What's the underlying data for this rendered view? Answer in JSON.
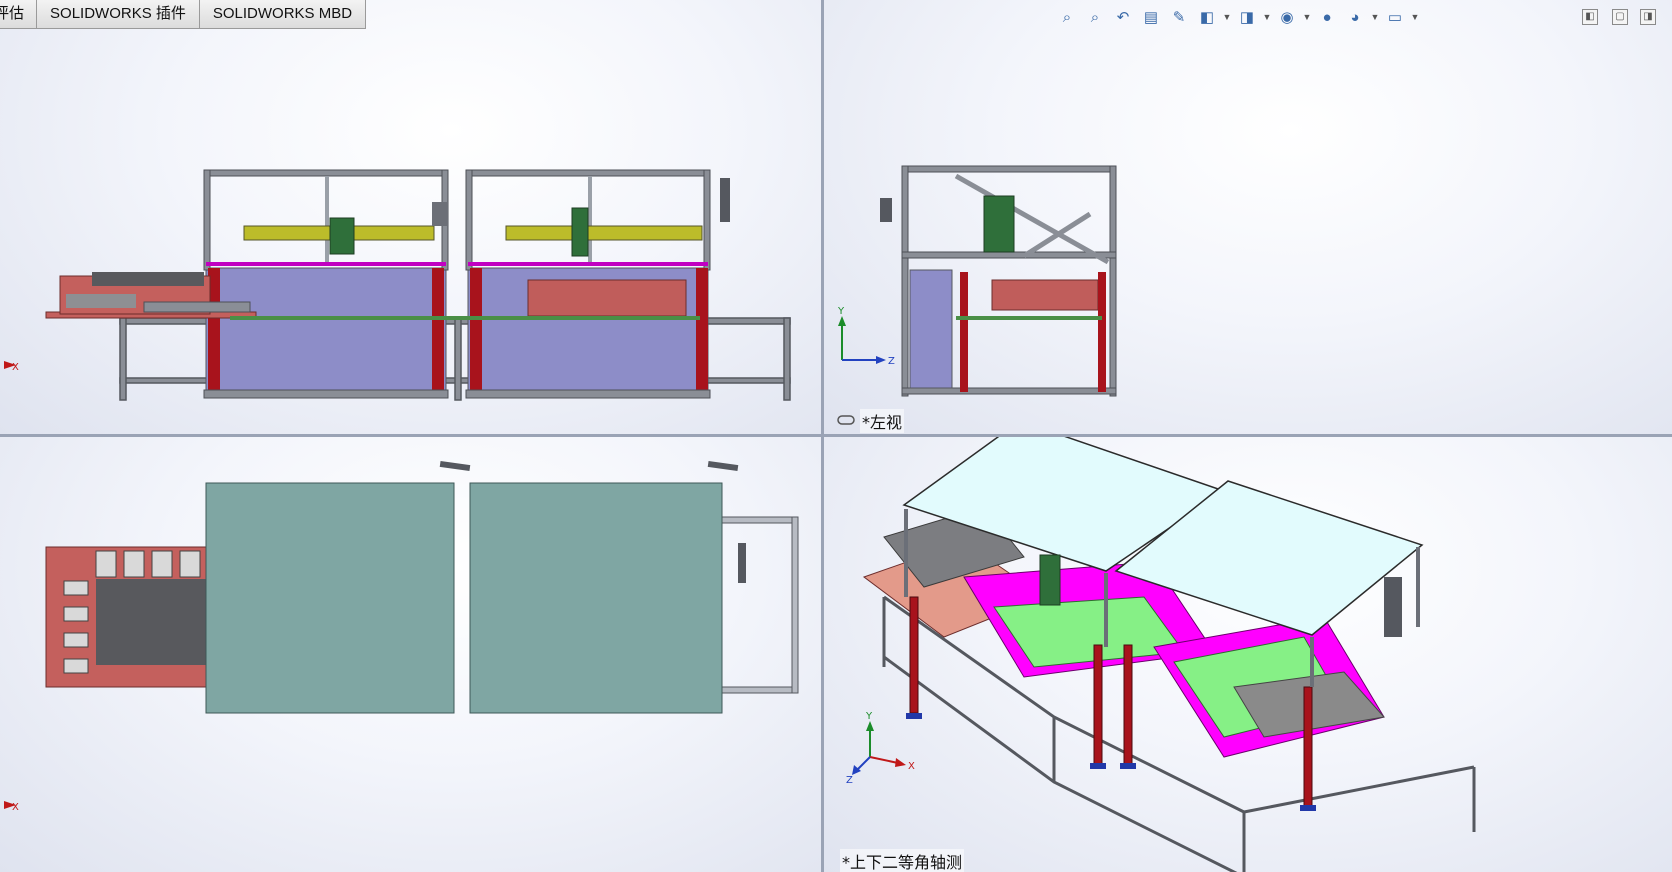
{
  "tabs": [
    {
      "label": "评估"
    },
    {
      "label": "SOLIDWORKS 插件"
    },
    {
      "label": "SOLIDWORKS MBD"
    }
  ],
  "viewports": {
    "top_left": {
      "axis_label": "X"
    },
    "top_right": {
      "view_name": "*左视",
      "axis_y": "Y",
      "axis_z": "Z"
    },
    "bottom_left": {
      "axis_label": "X"
    },
    "bottom_right": {
      "view_name": "*上下二等角轴测",
      "axis_y": "Y",
      "axis_x": "X",
      "axis_z": "Z"
    }
  },
  "heads_up_toolbar": [
    {
      "icon": "zoom-to-fit-icon"
    },
    {
      "icon": "zoom-to-area-icon"
    },
    {
      "icon": "previous-view-icon"
    },
    {
      "icon": "section-view-icon"
    },
    {
      "icon": "dynamic-annotation-icon"
    },
    {
      "icon": "view-orientation-icon"
    },
    {
      "icon": "display-style-icon"
    },
    {
      "icon": "hide-show-items-icon"
    },
    {
      "icon": "edit-appearance-icon"
    },
    {
      "icon": "apply-scene-icon"
    },
    {
      "icon": "view-settings-icon"
    }
  ],
  "colors": {
    "frame": "#6b6f78",
    "leg": "#a8131c",
    "panel_purple": "#8d8dc8",
    "cover_teal": "#7fa6a3",
    "pink_plate": "#c8605e",
    "magenta": "#ff00ff",
    "green": "#86f086",
    "olive": "#c8c800",
    "light_cyan": "#e2fbfd"
  }
}
